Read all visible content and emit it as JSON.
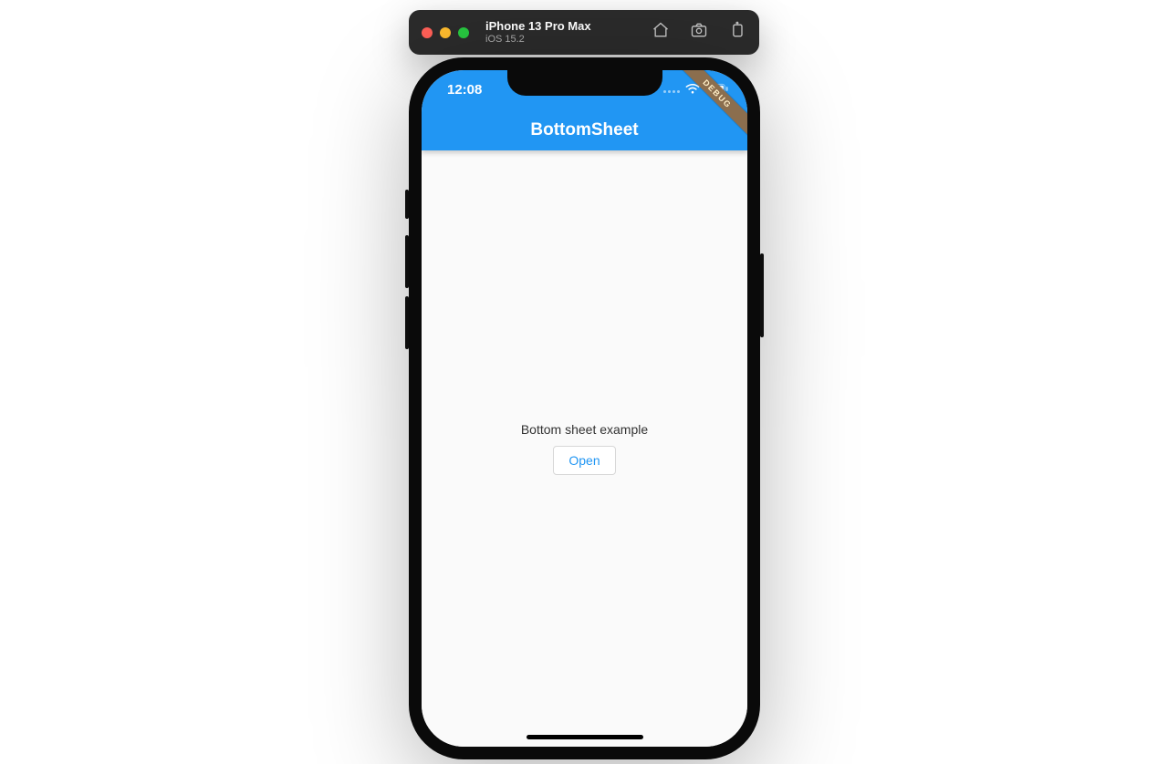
{
  "toolbar": {
    "device_name": "iPhone 13 Pro Max",
    "os_version": "iOS 15.2"
  },
  "statusbar": {
    "time": "12:08"
  },
  "debug_banner": "DEBUG",
  "appbar": {
    "title": "BottomSheet"
  },
  "body": {
    "message": "Bottom sheet example",
    "open_label": "Open"
  }
}
